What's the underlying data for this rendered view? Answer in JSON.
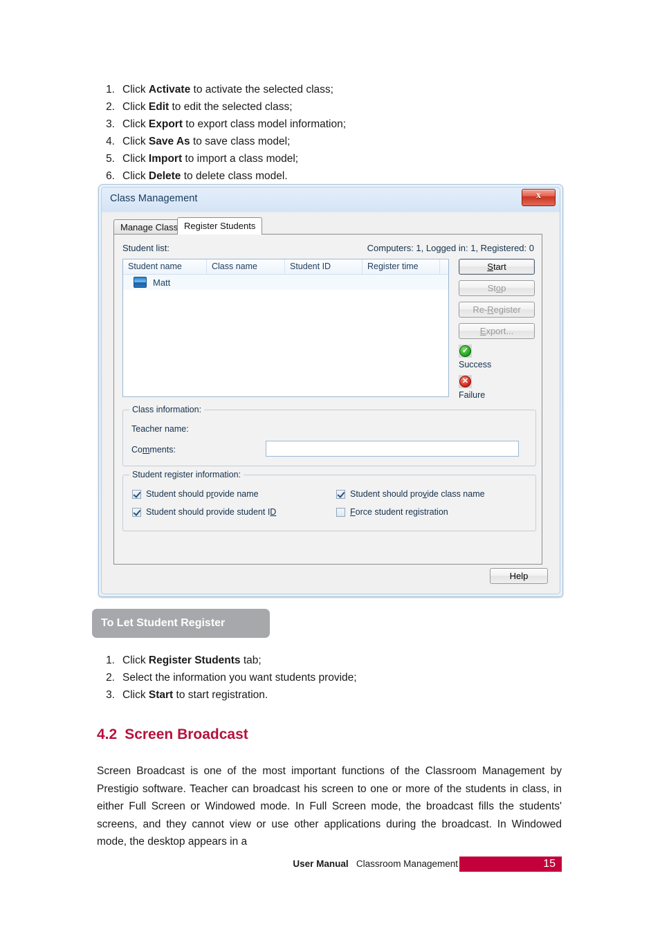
{
  "document": {
    "steps_top": [
      {
        "marker": "1.",
        "prefix": "Click ",
        "bold": "Activate",
        "suffix": " to activate the selected class;"
      },
      {
        "marker": "2.",
        "prefix": "Click ",
        "bold": "Edit",
        "suffix": " to edit the selected class;"
      },
      {
        "marker": "3.",
        "prefix": "Click ",
        "bold": "Export",
        "suffix": " to export class model information;"
      },
      {
        "marker": "4.",
        "prefix": "Click ",
        "bold": "Save As",
        "suffix": " to save class model;"
      },
      {
        "marker": "5.",
        "prefix": "Click ",
        "bold": "Import",
        "suffix": " to import a class model;"
      },
      {
        "marker": "6.",
        "prefix": "Click ",
        "bold": "Delete",
        "suffix": " to delete class model."
      }
    ],
    "banner": "To Let Student Register",
    "steps_mid": [
      {
        "marker": "1.",
        "prefix": "Click ",
        "bold": "Register Students",
        "suffix": " tab;"
      },
      {
        "marker": "2.",
        "prefix": "Select the information you want students provide;",
        "bold": "",
        "suffix": ""
      },
      {
        "marker": "3.",
        "prefix": "Click ",
        "bold": "Start",
        "suffix": " to start registration."
      }
    ],
    "heading": {
      "number": "4.2",
      "title": "Screen Broadcast",
      "color": "#b5123e"
    },
    "paragraph": "Screen Broadcast is one of the most important functions of the Classroom Management by Prestigio software. Teacher can broadcast his screen to one or more of the students in class, in either Full Screen or Windowed mode. In Full Screen mode, the broadcast fills the students' screens, and they cannot view or use other applications during the broadcast. In Windowed mode, the desktop appears in a",
    "footer": {
      "bold_label": "User Manual",
      "label": "Classroom Management",
      "page_number": "15",
      "accent_color": "#c4003c"
    }
  },
  "dialog": {
    "title": "Class Management",
    "close_label": "x",
    "tabs": [
      {
        "label": "Manage Class",
        "active": false
      },
      {
        "label": "Register Students",
        "active": true
      }
    ],
    "student_list_label": "Student list:",
    "counts_label": "Computers: 1, Logged in: 1, Registered: 0",
    "list": {
      "columns": [
        "Student name",
        "Class name",
        "Student ID",
        "Register time"
      ],
      "rows": [
        {
          "student_name": "Matt",
          "class_name": "",
          "student_id": "",
          "register_time": ""
        }
      ]
    },
    "buttons": [
      {
        "label": "Start",
        "mnemonic_index": 0,
        "state": "default"
      },
      {
        "label": "Stop",
        "mnemonic_index": 2,
        "state": "disabled"
      },
      {
        "label": "Re-Register",
        "mnemonic_index": 3,
        "state": "disabled"
      },
      {
        "label": "Export...",
        "mnemonic_index": 0,
        "state": "disabled"
      }
    ],
    "status": [
      {
        "label": "Success",
        "icon": "check-circle-green",
        "color": "#169b18"
      },
      {
        "label": "Failure",
        "icon": "x-circle-red",
        "color": "#cc1a12"
      }
    ],
    "class_information": {
      "legend": "Class information:",
      "teacher_name_label": "Teacher name:",
      "teacher_name_value": "",
      "comments_label": "Comments:",
      "comments_value": "",
      "comments_placeholder": ""
    },
    "student_register_information": {
      "legend": "Student register information:",
      "checkboxes": [
        {
          "label": "Student should provide name",
          "checked": true,
          "mnemonic_index": 15
        },
        {
          "label": "Student should provide class name",
          "checked": true,
          "mnemonic_index": 19
        },
        {
          "label": "Student should provide student ID",
          "checked": true,
          "mnemonic_index": 32
        },
        {
          "label": "Force student registration",
          "checked": false,
          "mnemonic_index": 0
        }
      ]
    },
    "help_label": "Help"
  }
}
